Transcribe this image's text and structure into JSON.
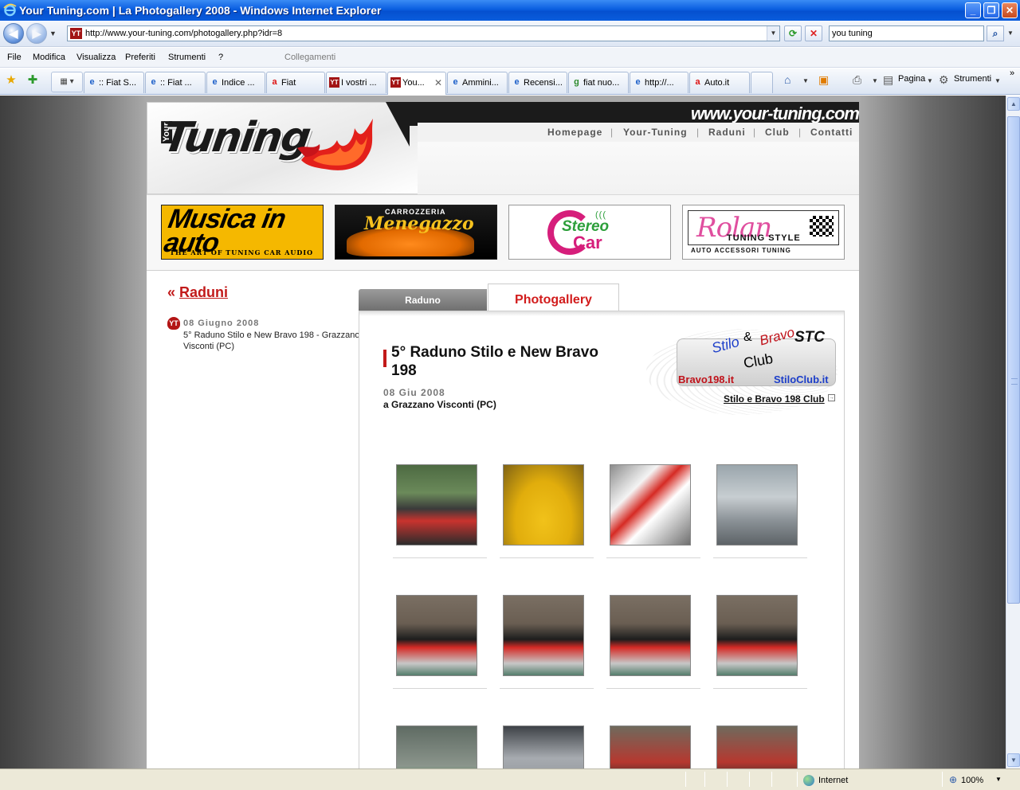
{
  "window": {
    "title": "Your Tuning.com | La Photogallery 2008 - Windows Internet Explorer",
    "minimize": "_",
    "restore": "❐",
    "close": "✕"
  },
  "address_bar": {
    "url": "http://www.your-tuning.com/photogallery.php?idr=8",
    "search_value": "you tuning"
  },
  "menu": {
    "items": [
      "File",
      "Modifica",
      "Visualizza",
      "Preferiti",
      "Strumenti",
      "?"
    ],
    "links_label": "Collegamenti"
  },
  "tabs": [
    {
      "label": ":: Fiat S..."
    },
    {
      "label": ":: Fiat ..."
    },
    {
      "label": "Indice ..."
    },
    {
      "label": "Fiat"
    },
    {
      "label": "I vostri ..."
    },
    {
      "label": "You..."
    },
    {
      "label": "Ammini..."
    },
    {
      "label": "Recensi..."
    },
    {
      "label": "fiat nuo..."
    },
    {
      "label": "http://..."
    },
    {
      "label": "Auto.it"
    }
  ],
  "command_bar": {
    "page_label": "Pagina",
    "tools_label": "Strumenti"
  },
  "status": {
    "zone": "Internet",
    "zoom": "100%"
  },
  "site": {
    "url_text": "www.your-tuning.com",
    "logo_small": "Your",
    "logo_big": "Tuning",
    "nav": [
      "Homepage",
      "Your-Tuning",
      "Raduni",
      "Club",
      "Contatti"
    ],
    "banners": {
      "musica_big": "Musica in auto",
      "musica_small": "THE ART OF TUNING CAR AUDIO",
      "menegazzo_top": "CARROZZERIA",
      "menegazzo_name": "Menegazzo",
      "stereo_st": "Stereo",
      "stereo_car": "Car",
      "rolan_name": "Rolan",
      "rolan_tuning": "TUNING STYLE",
      "rolan_sub": "AUTO ACCESSORI TUNING"
    }
  },
  "sidebar": {
    "back_prefix": "«",
    "back_label": "Raduni",
    "event_date": "08 Giugno 2008",
    "event_desc": "5° Raduno Stilo e New Bravo 198 - Grazzano Visconti (PC)"
  },
  "main": {
    "tab_raduno": "Raduno",
    "tab_photogallery": "Photogallery",
    "title": "5° Raduno Stilo e New Bravo 198",
    "date": "08 Giu 2008",
    "place": "a Grazzano Visconti (PC)",
    "club_link": "Stilo e Bravo 198 Club",
    "club_logo": {
      "stilo": "Stilo",
      "amp": "&",
      "bravo": "Bravo",
      "club": "Club",
      "stc": "STC",
      "bravo198": "Bravo198.it",
      "stiloclub": "StiloClub.it"
    },
    "photos": [
      {
        "scene": "crowd"
      },
      {
        "scene": "yellow-car"
      },
      {
        "scene": "rally-car"
      },
      {
        "scene": "silver-car"
      },
      {
        "scene": "group"
      },
      {
        "scene": "group"
      },
      {
        "scene": "group"
      },
      {
        "scene": "group"
      },
      {
        "scene": "car-flag"
      },
      {
        "scene": "silver-car-top"
      },
      {
        "scene": "crowd-cars"
      },
      {
        "scene": "crowd-cars"
      }
    ]
  }
}
